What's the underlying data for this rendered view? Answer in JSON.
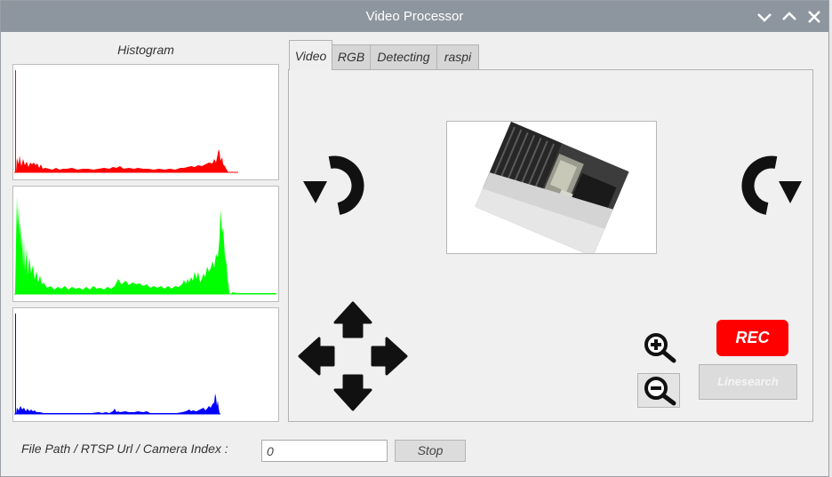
{
  "window": {
    "title": "Video Processor"
  },
  "histogram": {
    "title": "Histogram",
    "colors": {
      "red": "#ff0000",
      "green": "#00ff00",
      "blue": "#0000ff"
    }
  },
  "tabs": [
    {
      "label": "Video",
      "active": true
    },
    {
      "label": "RGB",
      "active": false
    },
    {
      "label": "Detecting",
      "active": false
    },
    {
      "label": "raspi",
      "active": false
    }
  ],
  "controls": {
    "rotate_left_icon": "rotate-ccw-icon",
    "rotate_right_icon": "rotate-cw-icon",
    "zoom_in_icon": "zoom-in-icon",
    "zoom_out_icon": "zoom-out-icon",
    "rec_label": "REC",
    "linesearch_label": "Linesearch",
    "rec_color": "#ff0000"
  },
  "source": {
    "label": "File Path / RTSP Url / Camera Index :",
    "value": "0",
    "stop_label": "Stop"
  }
}
